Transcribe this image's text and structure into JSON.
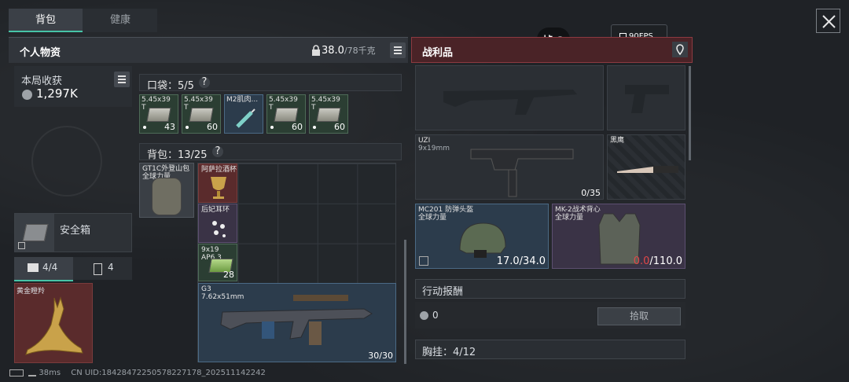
{
  "tabs": {
    "backpack": "背包",
    "health": "健康"
  },
  "left_header": {
    "title": "个人物资",
    "weight_value": "38.0",
    "weight_max": "/78千克"
  },
  "harvest": {
    "label": "本局收获",
    "value": "1,297K"
  },
  "safebox": {
    "label": "安全箱"
  },
  "slot_tabs": {
    "a": "4/4",
    "b": "4"
  },
  "gold_item": {
    "label": "黄金瞪羚"
  },
  "pocket": {
    "title": "口袋：5/5",
    "help": "?",
    "items": [
      {
        "label": "5.45x39\nT",
        "count": "43"
      },
      {
        "label": "5.45x39\nT",
        "count": "60"
      },
      {
        "label": "M2肌肉...",
        "count": ""
      },
      {
        "label": "5.45x39\nT",
        "count": "60"
      },
      {
        "label": "5.45x39\nT",
        "count": "60"
      }
    ]
  },
  "bag": {
    "title": "背包：13/25",
    "help": "?",
    "backpack_item": "GT1C外登山包\n全球力量",
    "items": [
      {
        "label": "阿萨拉酒杯",
        "count": ""
      },
      {
        "label": "后妃耳环",
        "count": ""
      },
      {
        "label": "9x19\nAP6.3",
        "count": "28"
      },
      {
        "label": "G3\n7.62x51mm",
        "count": "30/30"
      }
    ]
  },
  "loot": {
    "title": "战利品",
    "uzi": {
      "name": "UZI",
      "caliber": "9x19mm",
      "ammo": "0/35"
    },
    "knife": {
      "name": "黑鹰"
    },
    "helmet": {
      "name": "MC201 防弹头盔",
      "faction": "全球力量",
      "dur_cur": "17.0",
      "dur_max": "/34.0"
    },
    "vest": {
      "name": "MK-2战术背心",
      "faction": "全球力量",
      "dur_cur": "0.0",
      "dur_max": "/110.0"
    },
    "reward": {
      "title": "行动报酬",
      "value": "0",
      "button": "拾取"
    },
    "chest": {
      "title": "胸挂：4/12"
    }
  },
  "overlay": {
    "fps": "90FPS",
    "badge": "帧"
  },
  "footer": {
    "ping": "38ms",
    "uid": "CN UID:18428472250578227178_202511142242"
  },
  "colors": {
    "accent": "#47c4a7",
    "loot_red": "#8c3a40",
    "durability_zero": "#e04848"
  }
}
